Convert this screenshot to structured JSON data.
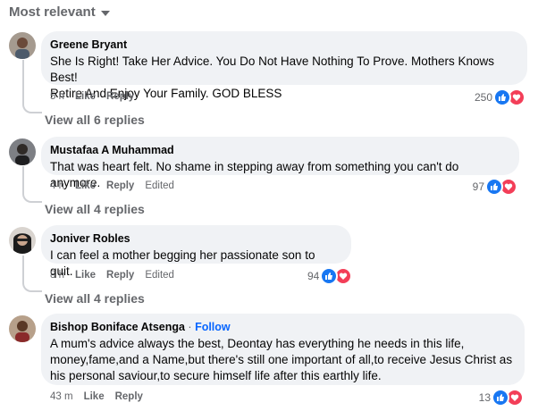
{
  "sort_label": "Most relevant",
  "comments": [
    {
      "author": "Greene Bryant",
      "follow": "",
      "lines": [
        "She Is Right! Take Her Advice. You Do Not Have Nothing To Prove. Mothers Knows Best!",
        "Retire And Enjoy Your Family. GOD BLESS"
      ],
      "time": "5 h",
      "like": "Like",
      "reply": "Reply",
      "edited": "",
      "reactions": "250",
      "replies": "View all 6 replies"
    },
    {
      "author": "Mustafaa A Muhammad",
      "follow": "",
      "lines": [
        "That was heart felt. No shame in stepping away from something you can't do anymore."
      ],
      "time": "4 h",
      "like": "Like",
      "reply": "Reply",
      "edited": "Edited",
      "reactions": "97",
      "replies": "View all 4 replies"
    },
    {
      "author": "Joniver Robles",
      "follow": "",
      "lines": [
        "I can feel a mother begging her passionate son to quit."
      ],
      "time": "8 h",
      "like": "Like",
      "reply": "Reply",
      "edited": "Edited",
      "reactions": "94",
      "replies": "View all 4 replies"
    },
    {
      "author": "Bishop Boniface Atsenga",
      "follow": "Follow",
      "lines": [
        "A mum's advice always the best, Deontay has everything he needs in this life,",
        "money,fame,and a Name,but there's still one important of all,to receive Jesus Christ as",
        "his personal saviour,to secure himself life after this earthly life."
      ],
      "time": "43 m",
      "like": "Like",
      "reply": "Reply",
      "edited": "",
      "reactions": "13",
      "replies": ""
    }
  ],
  "colors": {
    "like": "#1877f2",
    "love": "#f33e58",
    "link": "#0866ff",
    "bubble": "#f0f2f5"
  }
}
